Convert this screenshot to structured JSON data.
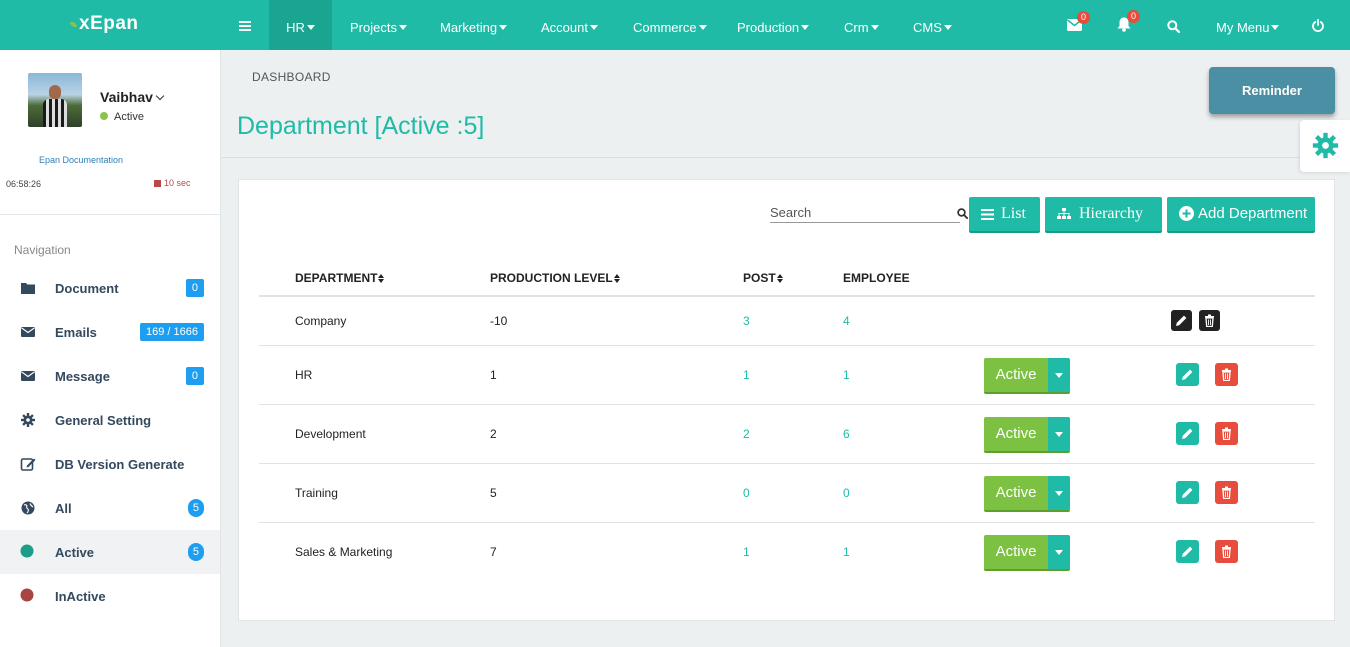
{
  "app": {
    "logo": "xEpan",
    "nav": [
      "HR",
      "Projects",
      "Marketing",
      "Account",
      "Commerce",
      "Production",
      "Crm",
      "CMS"
    ],
    "mail_count": "0",
    "notification_count": "0",
    "my_menu": "My Menu",
    "colors": {
      "accent": "#1fbba6",
      "active_green": "#7cc142",
      "delete_red": "#e74c3c",
      "badge_blue": "#1e9ef0"
    }
  },
  "user": {
    "name": "Vaibhav",
    "status": "Active",
    "doc_link": "Epan Documentation",
    "time": "06:58:26",
    "timer": "10 sec"
  },
  "sidebar": {
    "heading": "Navigation",
    "items": [
      {
        "label": "Document",
        "count": "0",
        "icon": "folder-icon"
      },
      {
        "label": "Emails",
        "count": "169 / 1666",
        "icon": "envelope-icon"
      },
      {
        "label": "Message",
        "count": "0",
        "icon": "envelope-icon"
      },
      {
        "label": "General Setting",
        "count": "",
        "icon": "gear-icon"
      },
      {
        "label": "DB Version Generate",
        "count": "",
        "icon": "edit-icon"
      },
      {
        "label": "All",
        "count": "5",
        "icon": "globe-icon"
      },
      {
        "label": "Active",
        "count": "5",
        "icon": "teal-dot-icon"
      },
      {
        "label": "InActive",
        "count": "",
        "icon": "red-dot-icon"
      }
    ]
  },
  "page": {
    "breadcrumb": "DASHBOARD",
    "title": "Department [Active :5]",
    "reminder": "Reminder"
  },
  "toolbar": {
    "search_placeholder": "Search",
    "list": "List",
    "hierarchy": "Hierarchy",
    "add_department": "Add Department"
  },
  "table": {
    "headers": [
      "DEPARTMENT",
      "PRODUCTION LEVEL",
      "POST",
      "EMPLOYEE"
    ],
    "rows": [
      {
        "department": "Company",
        "level": "-10",
        "post": "3",
        "employee": "4",
        "status": ""
      },
      {
        "department": "HR",
        "level": "1",
        "post": "1",
        "employee": "1",
        "status": "Active"
      },
      {
        "department": "Development",
        "level": "2",
        "post": "2",
        "employee": "6",
        "status": "Active"
      },
      {
        "department": "Training",
        "level": "5",
        "post": "0",
        "employee": "0",
        "status": "Active"
      },
      {
        "department": "Sales & Marketing",
        "level": "7",
        "post": "1",
        "employee": "1",
        "status": "Active"
      }
    ]
  }
}
